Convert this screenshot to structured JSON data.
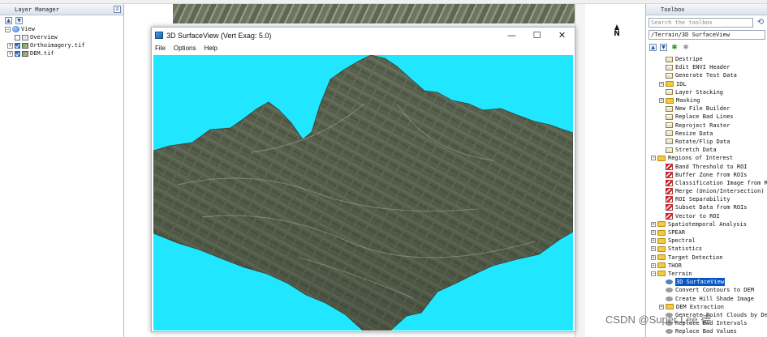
{
  "layer_manager": {
    "title": "Layer Manager",
    "tree": [
      {
        "label": "View",
        "kind": "view"
      },
      {
        "label": "Overview",
        "kind": "overview"
      },
      {
        "label": "Orthoimagery.tif",
        "kind": "image",
        "checked": true
      },
      {
        "label": "DEM.tif",
        "kind": "image",
        "checked": true
      }
    ]
  },
  "map": {
    "north_label": "N"
  },
  "surface_window": {
    "title": "3D SurfaceView (Vert Exag: 5.0)",
    "menu": [
      "File",
      "Options",
      "Help"
    ],
    "controls": {
      "minimize": "—",
      "maximize": "☐",
      "close": "✕"
    },
    "background_color": "#20e6ff"
  },
  "toolbox": {
    "title": "Toolbox",
    "search_placeholder": "Search the toolbox",
    "path": "/Terrain/3D SurfaceView",
    "items": [
      {
        "label": "Destripe",
        "level": 2,
        "icon": "tool"
      },
      {
        "label": "Edit ENVI Header",
        "level": 2,
        "icon": "tool"
      },
      {
        "label": "Generate Test Data",
        "level": 2,
        "icon": "tool"
      },
      {
        "label": "IDL",
        "level": 1,
        "icon": "folder",
        "expander": "+"
      },
      {
        "label": "Layer Stacking",
        "level": 2,
        "icon": "tool"
      },
      {
        "label": "Masking",
        "level": 1,
        "icon": "folder",
        "expander": "+"
      },
      {
        "label": "New File Builder",
        "level": 2,
        "icon": "tool"
      },
      {
        "label": "Replace Bad Lines",
        "level": 2,
        "icon": "tool"
      },
      {
        "label": "Reproject Raster",
        "level": 2,
        "icon": "tool"
      },
      {
        "label": "Resize Data",
        "level": 2,
        "icon": "tool"
      },
      {
        "label": "Rotate/Flip Data",
        "level": 2,
        "icon": "tool"
      },
      {
        "label": "Stretch Data",
        "level": 2,
        "icon": "tool"
      },
      {
        "label": "Regions of Interest",
        "level": 0,
        "icon": "folder",
        "expander": "−"
      },
      {
        "label": "Band Threshold to ROI",
        "level": 2,
        "icon": "roi"
      },
      {
        "label": "Buffer Zone from ROIs",
        "level": 2,
        "icon": "roi"
      },
      {
        "label": "Classification Image from ROIs",
        "level": 2,
        "icon": "roi"
      },
      {
        "label": "Merge (Union/Intersection) ROIs",
        "level": 2,
        "icon": "roi"
      },
      {
        "label": "ROI Separability",
        "level": 2,
        "icon": "roi"
      },
      {
        "label": "Subset Data from ROIs",
        "level": 2,
        "icon": "roi"
      },
      {
        "label": "Vector to ROI",
        "level": 2,
        "icon": "roi"
      },
      {
        "label": "Spatiotemporal Analysis",
        "level": 0,
        "icon": "folder",
        "expander": "+"
      },
      {
        "label": "SPEAR",
        "level": 0,
        "icon": "folder",
        "expander": "+"
      },
      {
        "label": "Spectral",
        "level": 0,
        "icon": "folder",
        "expander": "+"
      },
      {
        "label": "Statistics",
        "level": 0,
        "icon": "folder",
        "expander": "+"
      },
      {
        "label": "Target Detection",
        "level": 0,
        "icon": "folder",
        "expander": "+"
      },
      {
        "label": "THOR",
        "level": 0,
        "icon": "folder",
        "expander": "+"
      },
      {
        "label": "Terrain",
        "level": 0,
        "icon": "folder",
        "expander": "−"
      },
      {
        "label": "3D SurfaceView",
        "level": 2,
        "icon": "oval-blue",
        "selected": true
      },
      {
        "label": "Convert Contours to DEM",
        "level": 2,
        "icon": "oval"
      },
      {
        "label": "Create Hill Shade Image",
        "level": 2,
        "icon": "oval"
      },
      {
        "label": "DEM Extraction",
        "level": 1,
        "icon": "folder",
        "expander": "+"
      },
      {
        "label": "Generate Point Clouds by Dense",
        "level": 2,
        "icon": "oval"
      },
      {
        "label": "Replace Bad Intervals",
        "level": 2,
        "icon": "oval"
      },
      {
        "label": "Replace Bad Values",
        "level": 2,
        "icon": "oval"
      }
    ]
  },
  "watermark": "CSDN @Super Lee 德"
}
